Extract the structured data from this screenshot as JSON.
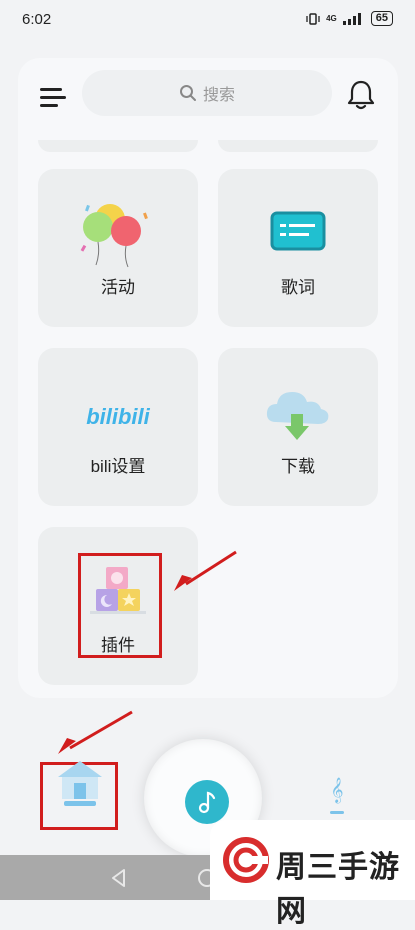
{
  "status_bar": {
    "time": "6:02",
    "network": "4G",
    "battery": "65"
  },
  "header": {
    "search_placeholder": "搜索"
  },
  "cards": [
    {
      "id": "activity",
      "label": "活动",
      "icon": "balloons-icon"
    },
    {
      "id": "lyrics",
      "label": "歌词",
      "icon": "lyrics-screen-icon"
    },
    {
      "id": "bili",
      "label": "bili设置",
      "icon": "bilibili-logo-icon",
      "logo_text": "bilibili"
    },
    {
      "id": "download",
      "label": "下载",
      "icon": "cloud-download-icon"
    },
    {
      "id": "plugin",
      "label": "插件",
      "icon": "building-blocks-icon"
    }
  ],
  "bottom_nav": {
    "home": "home-icon",
    "play": "music-note-icon",
    "music": "treble-clef-icon"
  },
  "watermark": {
    "text": "周三手游网"
  },
  "colors": {
    "accent": "#2fb7cc",
    "highlight": "#d11d1d",
    "panel": "#f7f8fa",
    "card": "#eceeef"
  }
}
